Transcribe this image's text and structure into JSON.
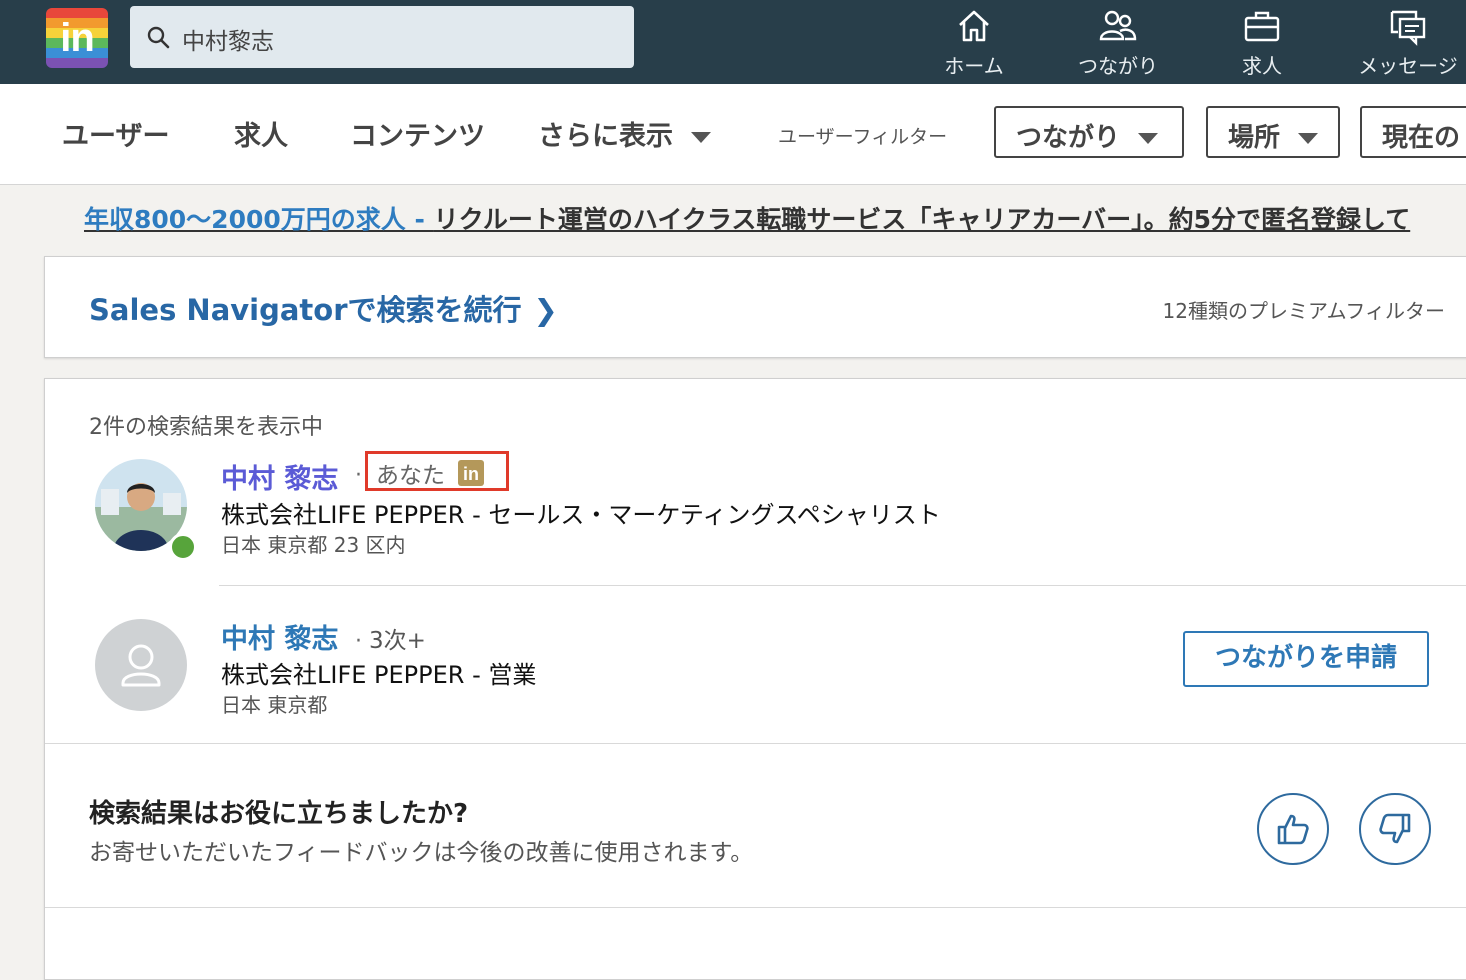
{
  "topbar": {
    "search_value": "中村黎志",
    "nav": [
      {
        "label": "ホーム",
        "icon": "home-icon"
      },
      {
        "label": "つながり",
        "icon": "network-icon"
      },
      {
        "label": "求人",
        "icon": "briefcase-icon"
      },
      {
        "label": "メッセージ",
        "icon": "messages-icon"
      }
    ]
  },
  "subnav": {
    "tabs": [
      "ユーザー",
      "求人",
      "コンテンツ",
      "さらに表示"
    ],
    "filter_label": "ユーザーフィルター",
    "filters": [
      "つながり",
      "場所",
      "現在の"
    ]
  },
  "ad": {
    "link": "年収800〜2000万円の求人 - ",
    "text": "リクルート運営のハイクラス転職サービス「キャリアカーバー」。約5分で匿名登録して"
  },
  "sales": {
    "title": "Sales Navigatorで検索を続行",
    "premium": "12種類のプレミアムフィルター"
  },
  "results": {
    "count": "2件の検索結果を表示中",
    "items": [
      {
        "name": "中村 黎志",
        "badge": "あなた",
        "headline": "株式会社LIFE PEPPER - セールス・マーケティングスペシャリスト",
        "location": "日本 東京都 23 区内"
      },
      {
        "name": "中村 黎志",
        "degree": "3次+",
        "headline": "株式会社LIFE PEPPER - 営業",
        "location": "日本 東京都",
        "action": "つながりを申請"
      }
    ]
  },
  "feedback": {
    "title": "検索結果はお役に立ちましたか?",
    "subtitle": "お寄せいただいたフィードバックは今後の改善に使用されます。"
  },
  "colors": {
    "topbar": "#283e4a",
    "link_blue": "#2e78b6",
    "highlight_red": "#e03a2a",
    "online_green": "#57a43b",
    "name_purple": "#5b5bd6"
  }
}
